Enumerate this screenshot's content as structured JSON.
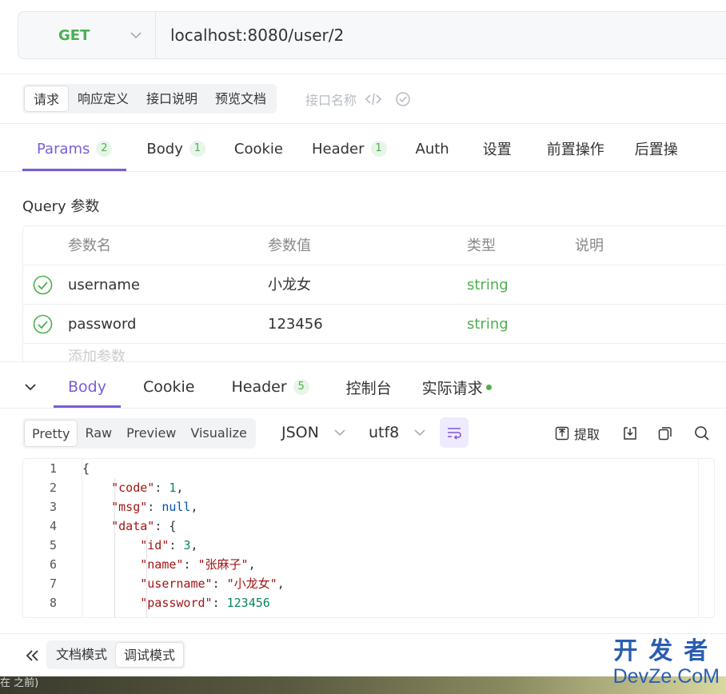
{
  "request": {
    "method": "GET",
    "url": "localhost:8080/user/2"
  },
  "subtabs": [
    {
      "label": "请求",
      "active": true
    },
    {
      "label": "响应定义",
      "active": false
    },
    {
      "label": "接口说明",
      "active": false
    },
    {
      "label": "预览文档",
      "active": false
    }
  ],
  "api_name_placeholder": "接口名称",
  "main_tabs": [
    {
      "label": "Params",
      "badge": "2",
      "active": true
    },
    {
      "label": "Body",
      "badge": "1",
      "active": false
    },
    {
      "label": "Cookie",
      "badge": "",
      "active": false
    },
    {
      "label": "Header",
      "badge": "1",
      "active": false
    },
    {
      "label": "Auth",
      "badge": "",
      "active": false
    },
    {
      "label": "设置",
      "badge": "",
      "active": false
    },
    {
      "label": "前置操作",
      "badge": "",
      "active": false
    },
    {
      "label": "后置操",
      "badge": "",
      "active": false
    }
  ],
  "query_section_title": "Query 参数",
  "params_table": {
    "headers": [
      "参数名",
      "参数值",
      "类型",
      "说明"
    ],
    "rows": [
      {
        "name": "username",
        "value": "小龙女",
        "type": "string",
        "desc": ""
      },
      {
        "name": "password",
        "value": "123456",
        "type": "string",
        "desc": ""
      }
    ],
    "add_row_hint": "添加参数"
  },
  "response_tabs": [
    {
      "label": "Body",
      "badge": "",
      "active": true
    },
    {
      "label": "Cookie",
      "badge": "",
      "active": false
    },
    {
      "label": "Header",
      "badge": "5",
      "active": false
    },
    {
      "label": "控制台",
      "badge": "",
      "active": false
    },
    {
      "label": "实际请求",
      "badge": "",
      "active": false
    }
  ],
  "view_tabs": [
    {
      "label": "Pretty",
      "active": true
    },
    {
      "label": "Raw",
      "active": false
    },
    {
      "label": "Preview",
      "active": false
    },
    {
      "label": "Visualize",
      "active": false
    }
  ],
  "format_select": "JSON",
  "encoding_select": "utf8",
  "extract_label": "提取",
  "code_lines": [
    {
      "num": "1",
      "text": "{"
    },
    {
      "num": "2",
      "text": "    \"code\": 1,"
    },
    {
      "num": "3",
      "text": "    \"msg\": null,"
    },
    {
      "num": "4",
      "text": "    \"data\": {"
    },
    {
      "num": "5",
      "text": "        \"id\": 3,"
    },
    {
      "num": "6",
      "text": "        \"name\": \"张麻子\","
    },
    {
      "num": "7",
      "text": "        \"username\": \"小龙女\","
    },
    {
      "num": "8",
      "text": "        \"password\": 123456"
    }
  ],
  "modes": [
    {
      "label": "文档模式",
      "active": false
    },
    {
      "label": "调试模式",
      "active": true
    }
  ],
  "taskbar_text": "在 之前)",
  "watermark": {
    "line1": "开发者",
    "line2": "DevZe.CoM"
  },
  "colors": {
    "accent": "#7c5cd6",
    "get_method": "#4caf50",
    "string_type": "#4caf50"
  }
}
